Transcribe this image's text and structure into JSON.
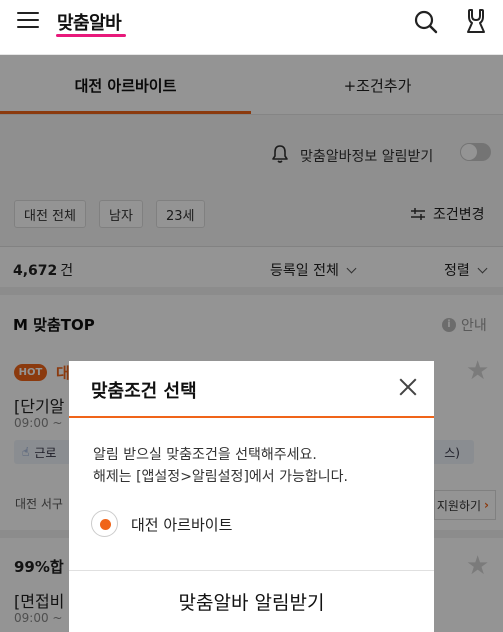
{
  "header": {
    "title": "맞춤알바",
    "accent_color": "#e8197b",
    "menu_icon": "hamburger-menu-icon",
    "search_icon": "search-icon",
    "profile_icon": "user-icon"
  },
  "tabs": [
    {
      "label": "대전 아르바이트",
      "active": true
    },
    {
      "label": "+조건추가",
      "active": false
    }
  ],
  "alarm": {
    "label": "맞춤알바정보 알림받기",
    "enabled": false
  },
  "filters": {
    "chips": [
      "대전 전체",
      "남자",
      "23세"
    ],
    "change_label": "조건변경"
  },
  "list": {
    "count": "4,672",
    "count_unit": "건",
    "date_filter": "등록일 전체",
    "sort_label": "정렬"
  },
  "mtop": {
    "title": "M 맞춤TOP",
    "guide_label": "안내"
  },
  "jobs": [
    {
      "badge": "HOT",
      "title_prefix": "대",
      "title": "[단기알",
      "time": "09:00 ~",
      "tag": "근로",
      "tag_end": "스)",
      "location": "대전 서구",
      "apply_label": "지원하기"
    },
    {
      "rate": "99%합",
      "title": "[면접비",
      "time": "09:00 ~"
    }
  ],
  "modal": {
    "title": "맞춤조건 선택",
    "desc_line1": "알림 받으실 맞춤조건을 선택해주세요.",
    "desc_line2": "해제는 [앱설정>알림설정]에서 가능합니다.",
    "option": "대전 아르바이트",
    "option_selected": true,
    "confirm_label": "맞춤알바 알림받기"
  },
  "colors": {
    "brand_orange": "#f06419",
    "overlay": "rgba(0,0,0,0.42)"
  }
}
